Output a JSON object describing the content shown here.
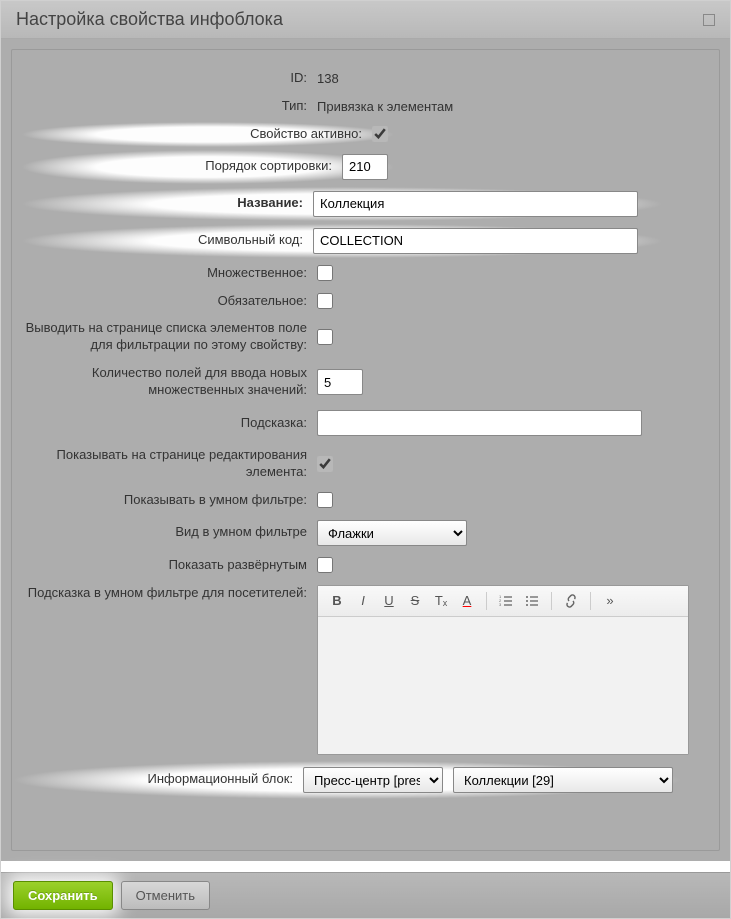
{
  "dialog": {
    "title": "Настройка свойства инфоблока"
  },
  "fields": {
    "id_label": "ID:",
    "id_value": "138",
    "type_label": "Тип:",
    "type_value": "Привязка к элементам",
    "active_label": "Свойство активно:",
    "sort_label": "Порядок сортировки:",
    "sort_value": "210",
    "name_label": "Название:",
    "name_value": "Коллекция",
    "code_label": "Символьный код:",
    "code_value": "COLLECTION",
    "multiple_label": "Множественное:",
    "required_label": "Обязательное:",
    "filter_label": "Выводить на странице списка элементов поле для фильтрации по этому свойству:",
    "mvcount_label": "Количество полей для ввода новых множественных значений:",
    "mvcount_value": "5",
    "hint_label": "Подсказка:",
    "hint_value": "",
    "show_edit_label": "Показывать на странице редактирования элемента:",
    "smart_filter_label": "Показывать в умном фильтре:",
    "smart_view_label": "Вид в умном фильтре",
    "smart_view_value": "Флажки",
    "expanded_label": "Показать развёрнутым",
    "smart_hint_label": "Подсказка в умном фильтре для посетителей:",
    "iblock_label": "Информационный блок:",
    "iblock_type_value": "Пресс-центр [presscenter]",
    "iblock_value": "Коллекции [29]"
  },
  "toolbar": {
    "bold": "B",
    "italic": "I",
    "underline": "U",
    "strike": "S",
    "clear": "Tₓ",
    "color": "A",
    "ol": "≡",
    "ul": "≡",
    "link": "🔗",
    "more": "»"
  },
  "buttons": {
    "save": "Сохранить",
    "cancel": "Отменить"
  }
}
